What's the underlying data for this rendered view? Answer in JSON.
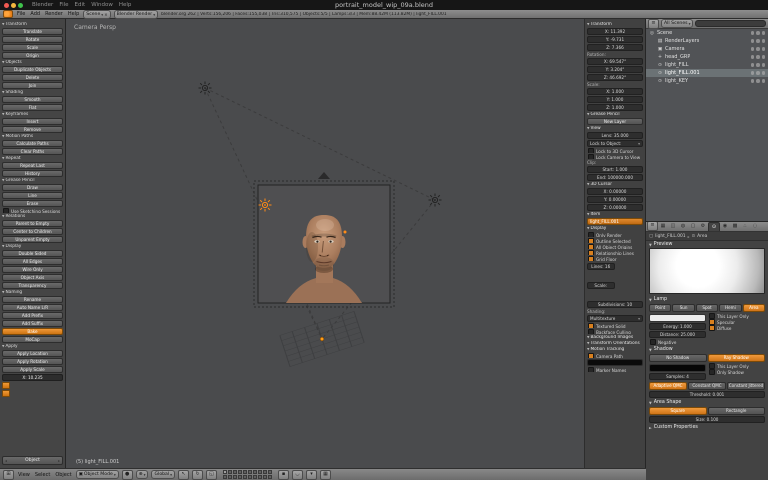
{
  "window": {
    "title": "portrait_model_wip_09a.blend",
    "menus": [
      "Blender",
      "File",
      "Edit",
      "Window",
      "Help"
    ]
  },
  "info_header": {
    "menus": [
      "File",
      "Add",
      "Render",
      "Help"
    ],
    "scene_name": "Scene",
    "engine": "Blender Render",
    "stats": "blender.org 262 | Verts:156,206 | Faces:155,038 | Tris:310,575 | Objects:5/5 | Lamps:3/3 | Mem:88.42M (113.82M) | light_FILL.001"
  },
  "tool_shelf": {
    "bottom_selector": "Object",
    "items": [
      {
        "kind": "hdr",
        "label": "Transform"
      },
      {
        "kind": "btn",
        "label": "Translate"
      },
      {
        "kind": "btn",
        "label": "Rotate"
      },
      {
        "kind": "btn",
        "label": "Scale"
      },
      {
        "kind": "btn",
        "label": "Origin"
      },
      {
        "kind": "hdr",
        "label": "Objects"
      },
      {
        "kind": "btn",
        "label": "Duplicate Objects"
      },
      {
        "kind": "btn",
        "label": "Delete"
      },
      {
        "kind": "btn",
        "label": "Join"
      },
      {
        "kind": "hdr",
        "label": "Shading"
      },
      {
        "kind": "btn",
        "label": "Smooth"
      },
      {
        "kind": "btn",
        "label": "Flat"
      },
      {
        "kind": "hdr",
        "label": "Keyframes"
      },
      {
        "kind": "btn",
        "label": "Insert"
      },
      {
        "kind": "btn",
        "label": "Remove"
      },
      {
        "kind": "hdr",
        "label": "Motion Paths"
      },
      {
        "kind": "btn",
        "label": "Calculate Paths"
      },
      {
        "kind": "btn",
        "label": "Clear Paths"
      },
      {
        "kind": "hdr",
        "label": "Repeat"
      },
      {
        "kind": "btn",
        "label": "Repeat Last"
      },
      {
        "kind": "btn",
        "label": "History"
      },
      {
        "kind": "hdr",
        "label": "Grease Pencil"
      },
      {
        "kind": "btn",
        "label": "Draw"
      },
      {
        "kind": "btn",
        "label": "Line"
      },
      {
        "kind": "btn",
        "label": "Erase"
      },
      {
        "kind": "chk",
        "label": "Use Sketching Sessions"
      },
      {
        "kind": "hdr",
        "label": "Relations"
      },
      {
        "kind": "btn",
        "label": "Parent to Empty"
      },
      {
        "kind": "btn",
        "label": "Center to Children"
      },
      {
        "kind": "btn",
        "label": "Unparent Empty"
      },
      {
        "kind": "hdr",
        "label": "Display"
      },
      {
        "kind": "btn",
        "label": "Double Sided"
      },
      {
        "kind": "btn",
        "label": "All Edges"
      },
      {
        "kind": "btn",
        "label": "Wire Only"
      },
      {
        "kind": "btn",
        "label": "Object Axis"
      },
      {
        "kind": "btn",
        "label": "Transparency"
      },
      {
        "kind": "hdr",
        "label": "Naming"
      },
      {
        "kind": "btn",
        "label": "Rename"
      },
      {
        "kind": "btn",
        "label": "Auto Name L/R"
      },
      {
        "kind": "btn",
        "label": "Add Prefix"
      },
      {
        "kind": "btn",
        "label": "Add Suffix"
      },
      {
        "kind": "orange",
        "label": "Bake"
      },
      {
        "kind": "btn",
        "label": "MoCap"
      },
      {
        "kind": "hdr",
        "label": "Apply"
      },
      {
        "kind": "btn",
        "label": "Apply Location"
      },
      {
        "kind": "btn",
        "label": "Apply Rotation"
      },
      {
        "kind": "btn",
        "label": "Apply Scale"
      },
      {
        "kind": "slider",
        "label": "X: 10.235"
      },
      {
        "kind": "oicon",
        "label": ""
      },
      {
        "kind": "oicon",
        "label": ""
      }
    ]
  },
  "viewport": {
    "view_label": "Camera Persp",
    "active_object_label": "(5) light_FILL.001"
  },
  "n_panel": {
    "items": [
      {
        "kind": "hdr",
        "label": "Transform"
      },
      {
        "kind": "field",
        "label": "X: 11.392"
      },
      {
        "kind": "field",
        "label": "Y: -9.731"
      },
      {
        "kind": "field",
        "label": "Z: 7.366"
      },
      {
        "kind": "hdr2",
        "label": "Rotation:"
      },
      {
        "kind": "field",
        "label": "X: 69.547°"
      },
      {
        "kind": "field",
        "label": "Y: 3.204°"
      },
      {
        "kind": "field",
        "label": "Z: 46.692°"
      },
      {
        "kind": "hdr2",
        "label": "Scale:"
      },
      {
        "kind": "field",
        "label": "X: 1.000"
      },
      {
        "kind": "field",
        "label": "Y: 1.000"
      },
      {
        "kind": "field",
        "label": "Z: 1.000"
      },
      {
        "kind": "hdr",
        "label": "Grease Pencil"
      },
      {
        "kind": "btn",
        "label": "New Layer"
      },
      {
        "kind": "hdr",
        "label": "View"
      },
      {
        "kind": "field",
        "label": "Lens: 35.000"
      },
      {
        "kind": "dropdown",
        "label": "Lock to Object:"
      },
      {
        "kind": "chk",
        "label": "Lock to 3D Cursor"
      },
      {
        "kind": "chk",
        "label": "Lock Camera to View"
      },
      {
        "kind": "hdr2",
        "label": "Clip:"
      },
      {
        "kind": "field",
        "label": "Start: 1.000"
      },
      {
        "kind": "field",
        "label": "End: 100000.000"
      },
      {
        "kind": "hdr",
        "label": "3D Cursor"
      },
      {
        "kind": "field",
        "label": "X: 0.00000"
      },
      {
        "kind": "field",
        "label": "Y: 0.00000"
      },
      {
        "kind": "field",
        "label": "Z: 0.00000"
      },
      {
        "kind": "hdr",
        "label": "Item"
      },
      {
        "kind": "orange",
        "label": "light_FILL.001"
      },
      {
        "kind": "hdr",
        "label": "Display"
      },
      {
        "kind": "chk",
        "label": "Only Render"
      },
      {
        "kind": "chkon",
        "label": "Outline Selected"
      },
      {
        "kind": "chkon",
        "label": "All Object Origins"
      },
      {
        "kind": "chkon",
        "label": "Relationship Lines"
      },
      {
        "kind": "chkon",
        "label": "Grid Floor"
      },
      {
        "kind": "fieldh",
        "label": "Lines: 16"
      },
      {
        "kind": "fieldh",
        "label": "Scale: 1.000"
      },
      {
        "kind": "field",
        "label": "Subdivisions: 10"
      },
      {
        "kind": "hdr2",
        "label": "Shading:"
      },
      {
        "kind": "dropdown",
        "label": "Multitexture"
      },
      {
        "kind": "chkon",
        "label": "Textured Solid"
      },
      {
        "kind": "chk",
        "label": "Backface Culling"
      },
      {
        "kind": "hdr",
        "label": "Background Images"
      },
      {
        "kind": "hdr",
        "label": "Transform Orientations"
      },
      {
        "kind": "hdr",
        "label": "Motion Tracking"
      },
      {
        "kind": "chkon",
        "label": "Camera Path"
      },
      {
        "kind": "swatch",
        "label": ""
      },
      {
        "kind": "chk",
        "label": "Marker Names"
      }
    ]
  },
  "outliner": {
    "display_mode": "All Scenes",
    "rows": [
      {
        "kind": "root",
        "glyph": "◎",
        "label": "Scene"
      },
      {
        "kind": "child",
        "glyph": "▤",
        "label": "RenderLayers"
      },
      {
        "kind": "child",
        "glyph": "▣",
        "label": "Camera"
      },
      {
        "kind": "child",
        "glyph": "+",
        "label": "head_GRP"
      },
      {
        "kind": "child",
        "glyph": "⊙",
        "label": "light_FILL"
      },
      {
        "kind": "child active",
        "glyph": "⊙",
        "label": "light_FILL.001"
      },
      {
        "kind": "child",
        "glyph": "⊙",
        "label": "light_KEY"
      }
    ]
  },
  "properties": {
    "tabs": [
      {
        "glyph": "▦"
      },
      {
        "glyph": "◫"
      },
      {
        "glyph": "◍"
      },
      {
        "glyph": "▢"
      },
      {
        "glyph": "⚙"
      },
      {
        "kind": "active",
        "glyph": "⊙"
      },
      {
        "glyph": "◉"
      },
      {
        "glyph": "▩"
      },
      {
        "glyph": "∴"
      },
      {
        "glyph": "◌"
      }
    ],
    "breadcrumb": {
      "object": "light_FILL.001",
      "data": "Area"
    },
    "preview_title": "Preview",
    "lamp": {
      "title": "Lamp",
      "types": [
        {
          "label": "Point"
        },
        {
          "label": "Sun"
        },
        {
          "label": "Spot"
        },
        {
          "label": "Hemi"
        },
        {
          "kind": "active",
          "label": "Area"
        }
      ],
      "energy": "Energy: 1.000",
      "distance": "Distance: 25.000",
      "negative": "Negative",
      "options": [
        {
          "label": "This Layer Only"
        },
        {
          "kind": "on",
          "label": "Specular"
        },
        {
          "kind": "on",
          "label": "Diffuse"
        }
      ]
    },
    "shadow": {
      "title": "Shadow",
      "modes": [
        {
          "label": "No Shadow"
        },
        {
          "kind": "active",
          "label": "Ray Shadow"
        }
      ],
      "samples": "Samples: 4",
      "options": [
        {
          "label": "This Layer Only"
        },
        {
          "label": "Only Shadow"
        }
      ],
      "sampling": [
        {
          "kind": "active",
          "label": "Adaptive QMC"
        },
        {
          "label": "Constant QMC"
        },
        {
          "label": "Constant Jittered"
        }
      ],
      "threshold": "Threshold: 0.001"
    },
    "area_shape": {
      "title": "Area Shape",
      "shapes": [
        {
          "kind": "active",
          "label": "Square"
        },
        {
          "label": "Rectangle"
        }
      ],
      "size": "Size: 0.100"
    },
    "custom_properties": "Custom Properties"
  },
  "viewport_header": {
    "menus": [
      "View",
      "Select",
      "Object"
    ],
    "mode": "Object Mode",
    "orientation": "Global",
    "layers": [
      {
        "kind": "on"
      },
      {},
      {},
      {},
      {},
      {},
      {},
      {},
      {},
      {},
      {},
      {},
      {},
      {},
      {},
      {},
      {},
      {},
      {},
      {}
    ]
  }
}
